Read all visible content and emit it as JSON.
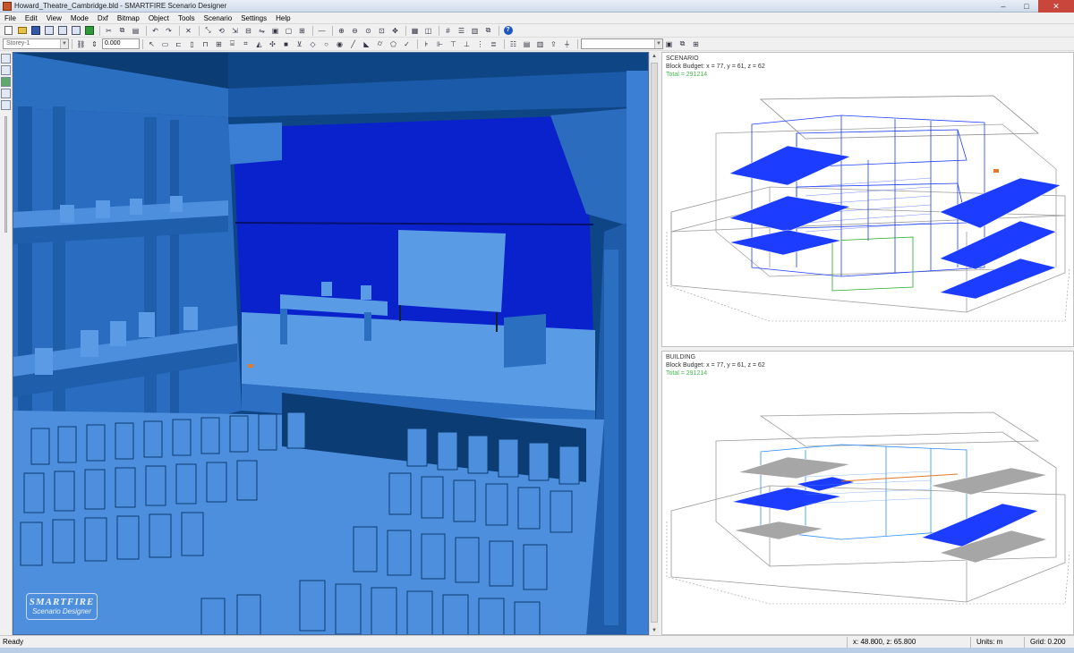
{
  "window": {
    "title": "Howard_Theatre_Cambridge.bld - SMARTFIRE Scenario Designer",
    "minimize": "–",
    "maximize": "□",
    "close": "✕"
  },
  "menu": [
    "File",
    "Edit",
    "View",
    "Mode",
    "Dxf",
    "Bitmap",
    "Object",
    "Tools",
    "Scenario",
    "Settings",
    "Help"
  ],
  "toolbar": {
    "storey_select": "Storey-1",
    "value_input": "0.000",
    "right_select": "",
    "icons": [
      "new-file",
      "open-folder",
      "save",
      "print",
      "cut",
      "undo",
      "redo",
      "zoom-in",
      "zoom-out",
      "help"
    ]
  },
  "view3d": {
    "logo_line1": "SMARTFIRE",
    "logo_line2": "Scenario Designer"
  },
  "scenario_panel": {
    "title": "SCENARIO",
    "budget": "Block Budget: x = 77, y = 61, z = 62",
    "total": "Total = 291214"
  },
  "building_panel": {
    "title": "BUILDING",
    "budget": "Block Budget: x = 77, y = 61, z = 62",
    "total": "Total = 291214"
  },
  "status": {
    "ready": "Ready",
    "coords": "x: 48.800, z: 65.800",
    "units": "Units: m",
    "grid": "Grid: 0.200"
  },
  "colors": {
    "view_background": "#0d3e78",
    "surface_light": "#4d8fdd",
    "stage_back": "#0a22cc",
    "wire_blue": "#1c3cff",
    "total_green": "#44b84c"
  }
}
